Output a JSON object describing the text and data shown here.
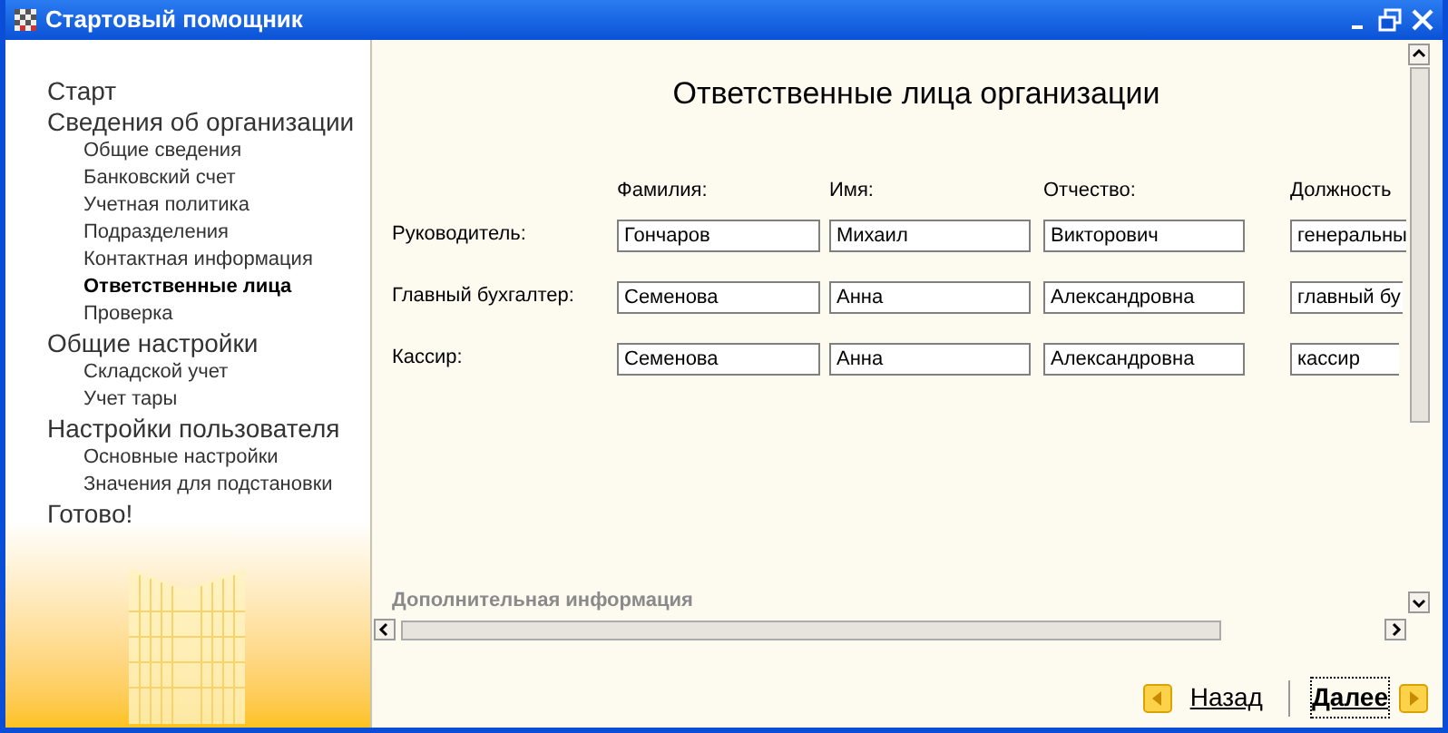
{
  "window": {
    "title": "Стартовый помощник"
  },
  "navigation": [
    {
      "label": "Старт",
      "selected": false
    },
    {
      "label": "Сведения об организации",
      "selected": false,
      "children": [
        {
          "label": "Общие сведения",
          "selected": false
        },
        {
          "label": "Банковский счет",
          "selected": false
        },
        {
          "label": "Учетная политика",
          "selected": false
        },
        {
          "label": "Подразделения",
          "selected": false
        },
        {
          "label": "Контактная информация",
          "selected": false
        },
        {
          "label": "Ответственные лица",
          "selected": true
        },
        {
          "label": "Проверка",
          "selected": false
        }
      ]
    },
    {
      "label": "Общие настройки",
      "selected": false,
      "children": [
        {
          "label": "Складской учет",
          "selected": false
        },
        {
          "label": "Учет тары",
          "selected": false
        }
      ]
    },
    {
      "label": "Настройки пользователя",
      "selected": false,
      "children": [
        {
          "label": "Основные настройки",
          "selected": false
        },
        {
          "label": "Значения для подстановки",
          "selected": false
        }
      ]
    },
    {
      "label": "Готово!",
      "selected": false
    }
  ],
  "page": {
    "heading": "Ответственные лица организации",
    "columns": [
      "Фамилия:",
      "Имя:",
      "Отчество:",
      "Должность"
    ],
    "rows": [
      {
        "label": "Руководитель:",
        "values": [
          "Гончаров",
          "Михаил",
          "Викторович",
          "генеральны"
        ]
      },
      {
        "label": "Главный бухгалтер:",
        "values": [
          "Семенова",
          "Анна",
          "Александровна",
          "главный бу"
        ]
      },
      {
        "label": "Кассир:",
        "values": [
          "Семенова",
          "Анна",
          "Александровна",
          "кассир"
        ]
      }
    ],
    "section": "Дополнительная информация"
  },
  "footer": {
    "back": "Назад",
    "next": "Далее"
  }
}
